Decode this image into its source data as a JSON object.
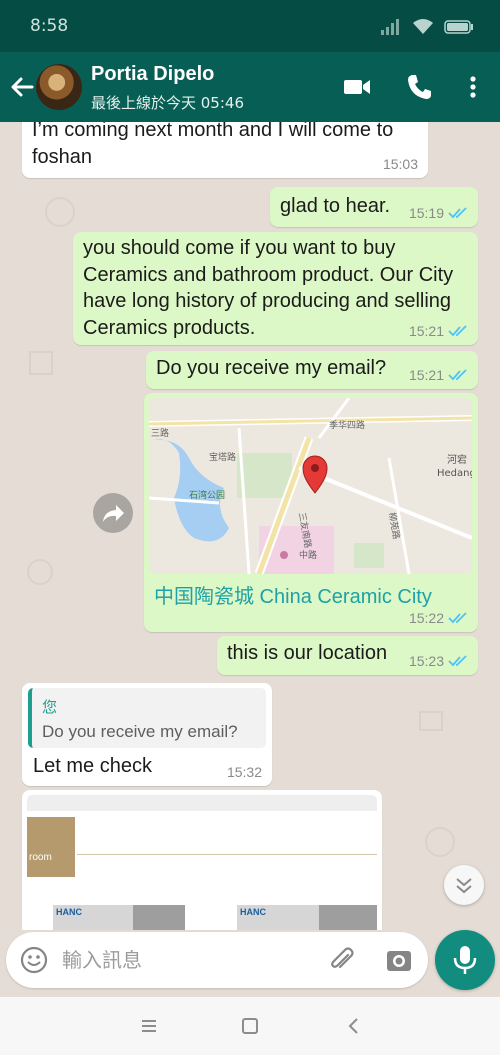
{
  "status_bar": {
    "time": "8:58"
  },
  "header": {
    "contact_name": "Portia Dipelo",
    "last_seen": "最後上線於今天 05:46",
    "icons": [
      "back-arrow-icon",
      "video-call-icon",
      "phone-icon",
      "more-vert-icon"
    ]
  },
  "messages": [
    {
      "dir": "in",
      "text": "I’m coming next month and I will come to foshan",
      "time": "15:03"
    },
    {
      "dir": "out",
      "text": "glad to hear.",
      "time": "15:19",
      "status": "read"
    },
    {
      "dir": "out",
      "text": "you should come if you want to buy Ceramics and bathroom product. Our City have long history of producing and selling Ceramics products.",
      "time": "15:21",
      "status": "read"
    },
    {
      "dir": "out",
      "text": "Do you receive my email?",
      "time": "15:21",
      "status": "read"
    },
    {
      "dir": "out",
      "type": "location",
      "title": "中国陶瓷城 China Ceramic City",
      "time": "15:22",
      "status": "read",
      "map_labels": [
        "季华四路",
        "三路",
        "宝塔路",
        "石湾公园",
        "河宕",
        "Hedang",
        "柳苑路",
        "三友南路",
        "中路"
      ]
    },
    {
      "dir": "out",
      "text": "this is our location",
      "time": "15:23",
      "status": "read"
    },
    {
      "dir": "in",
      "quoted_author": "您",
      "quoted_text": "Do you receive my email?",
      "text": "Let me check",
      "time": "15:32"
    },
    {
      "dir": "in",
      "type": "image",
      "image_labels": [
        "room",
        "HANC",
        "HANC"
      ]
    }
  ],
  "composer": {
    "placeholder": "輸入訊息",
    "icons": [
      "emoji-icon",
      "attach-icon",
      "camera-icon",
      "mic-icon"
    ]
  },
  "colors": {
    "header": "#075e54",
    "status_bar": "#054d44",
    "outgoing_bubble": "#dcf8c6",
    "incoming_bubble": "#ffffff",
    "accent": "#128c7e",
    "read_tick": "#4fc3f7",
    "link": "#1ea1a7"
  }
}
